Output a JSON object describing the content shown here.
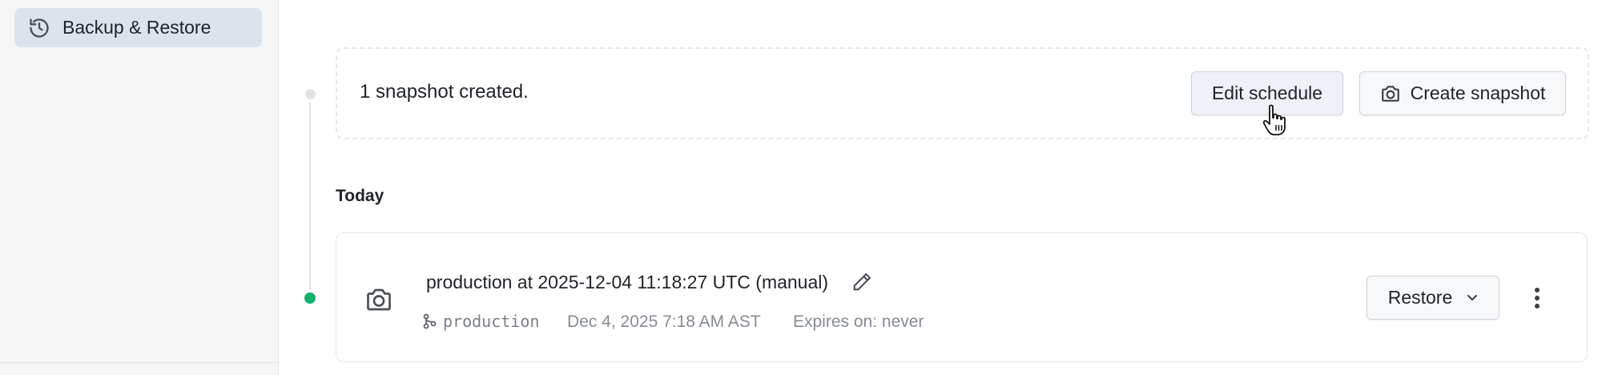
{
  "sidebar": {
    "active_item": {
      "label": "Backup & Restore",
      "icon": "history-icon"
    }
  },
  "summary": {
    "text": "1 snapshot created.",
    "edit_schedule_label": "Edit schedule",
    "create_snapshot_label": "Create snapshot"
  },
  "section": {
    "heading": "Today"
  },
  "snapshot": {
    "title": "production at 2025-12-04 11:18:27 UTC (manual)",
    "branch": "production",
    "date": "Dec 4, 2025 7:18 AM AST",
    "expires": "Expires on: never",
    "restore_label": "Restore",
    "status_color": "#10b26b"
  },
  "colors": {
    "active_nav_bg": "#dde3ec",
    "sidebar_bg": "#f6f6f6",
    "success_green": "#10b26b"
  }
}
